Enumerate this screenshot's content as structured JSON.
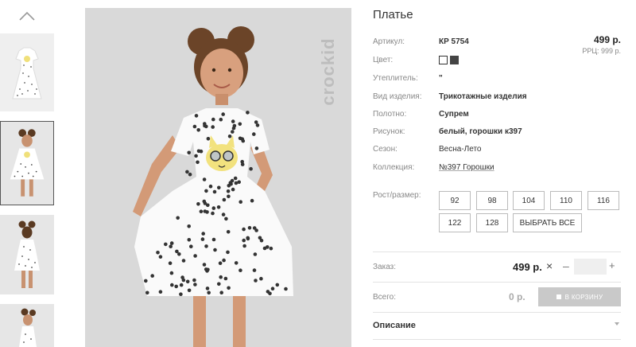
{
  "product": {
    "title": "Платье",
    "price": "499 р.",
    "rrp": "РРЦ: 999 р.",
    "brand": "crockid"
  },
  "specs": [
    {
      "label": "Артикул:",
      "value": "КР 5754"
    },
    {
      "label": "Цвет:",
      "value": ""
    },
    {
      "label": "Утеплитель:",
      "value": "\""
    },
    {
      "label": "Вид изделия:",
      "value": "Трикотажные изделия"
    },
    {
      "label": "Полотно:",
      "value": "Супрем"
    },
    {
      "label": "Рисунок:",
      "value": "белый, горошки к397"
    },
    {
      "label": "Сезон:",
      "value": "Весна-Лето"
    },
    {
      "label": "Коллекция:",
      "value": "№397 Горошки"
    }
  ],
  "colors": [
    "#ffffff",
    "#444444"
  ],
  "sizes": {
    "label": "Рост/размер:",
    "options": [
      "92",
      "98",
      "104",
      "110",
      "116",
      "122",
      "128"
    ],
    "select_all": "ВЫБРАТЬ ВСЕ"
  },
  "order": {
    "label": "Заказ:",
    "price": "499 р.",
    "remove": "×",
    "minus": "–",
    "plus": "+",
    "quantity": ""
  },
  "total": {
    "label": "Всего:",
    "value": "0 р.",
    "cart_button": "В КОРЗИНУ"
  },
  "description": {
    "label": "Описание"
  }
}
